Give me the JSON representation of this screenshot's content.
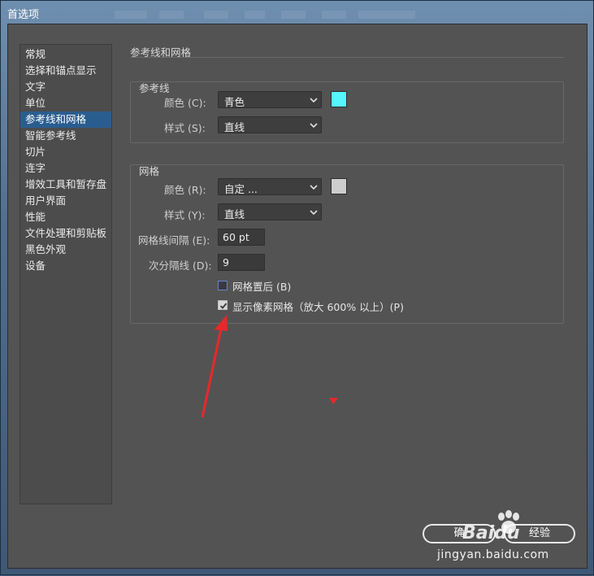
{
  "window": {
    "title": "首选项"
  },
  "sidebar": {
    "items": [
      {
        "label": "常规"
      },
      {
        "label": "选择和锚点显示"
      },
      {
        "label": "文字"
      },
      {
        "label": "单位"
      },
      {
        "label": "参考线和网格",
        "active": true
      },
      {
        "label": "智能参考线"
      },
      {
        "label": "切片"
      },
      {
        "label": "连字"
      },
      {
        "label": "增效工具和暂存盘"
      },
      {
        "label": "用户界面"
      },
      {
        "label": "性能"
      },
      {
        "label": "文件处理和剪贴板"
      },
      {
        "label": "黑色外观"
      },
      {
        "label": "设备"
      }
    ]
  },
  "main": {
    "section_title": "参考线和网格",
    "guides": {
      "title": "参考线",
      "color_label": "颜色 (C):",
      "color_value": "青色",
      "color_swatch": "#55f6ff",
      "style_label": "样式 (S):",
      "style_value": "直线"
    },
    "grid": {
      "title": "网格",
      "color_label": "颜色 (R):",
      "color_value": "自定 ...",
      "color_swatch": "#cdcdcd",
      "style_label": "样式 (Y):",
      "style_value": "直线",
      "spacing_label": "网格线间隔 (E):",
      "spacing_value": "60 pt",
      "subdivisions_label": "次分隔线 (D):",
      "subdivisions_value": "9",
      "grids_in_back_label": "网格置后 (B)",
      "grids_in_back_checked": false,
      "pixel_grid_label": "显示像素网格（放大 600% 以上）(P)",
      "pixel_grid_checked": true
    }
  },
  "footer": {
    "ok_label": "确",
    "cancel_label": "经验"
  },
  "watermark": {
    "brand": "Baidu",
    "url": "jingyan.baidu.com"
  },
  "colors": {
    "accent_selected": "#2a5d8f",
    "annotation_red": "#e8282a"
  }
}
